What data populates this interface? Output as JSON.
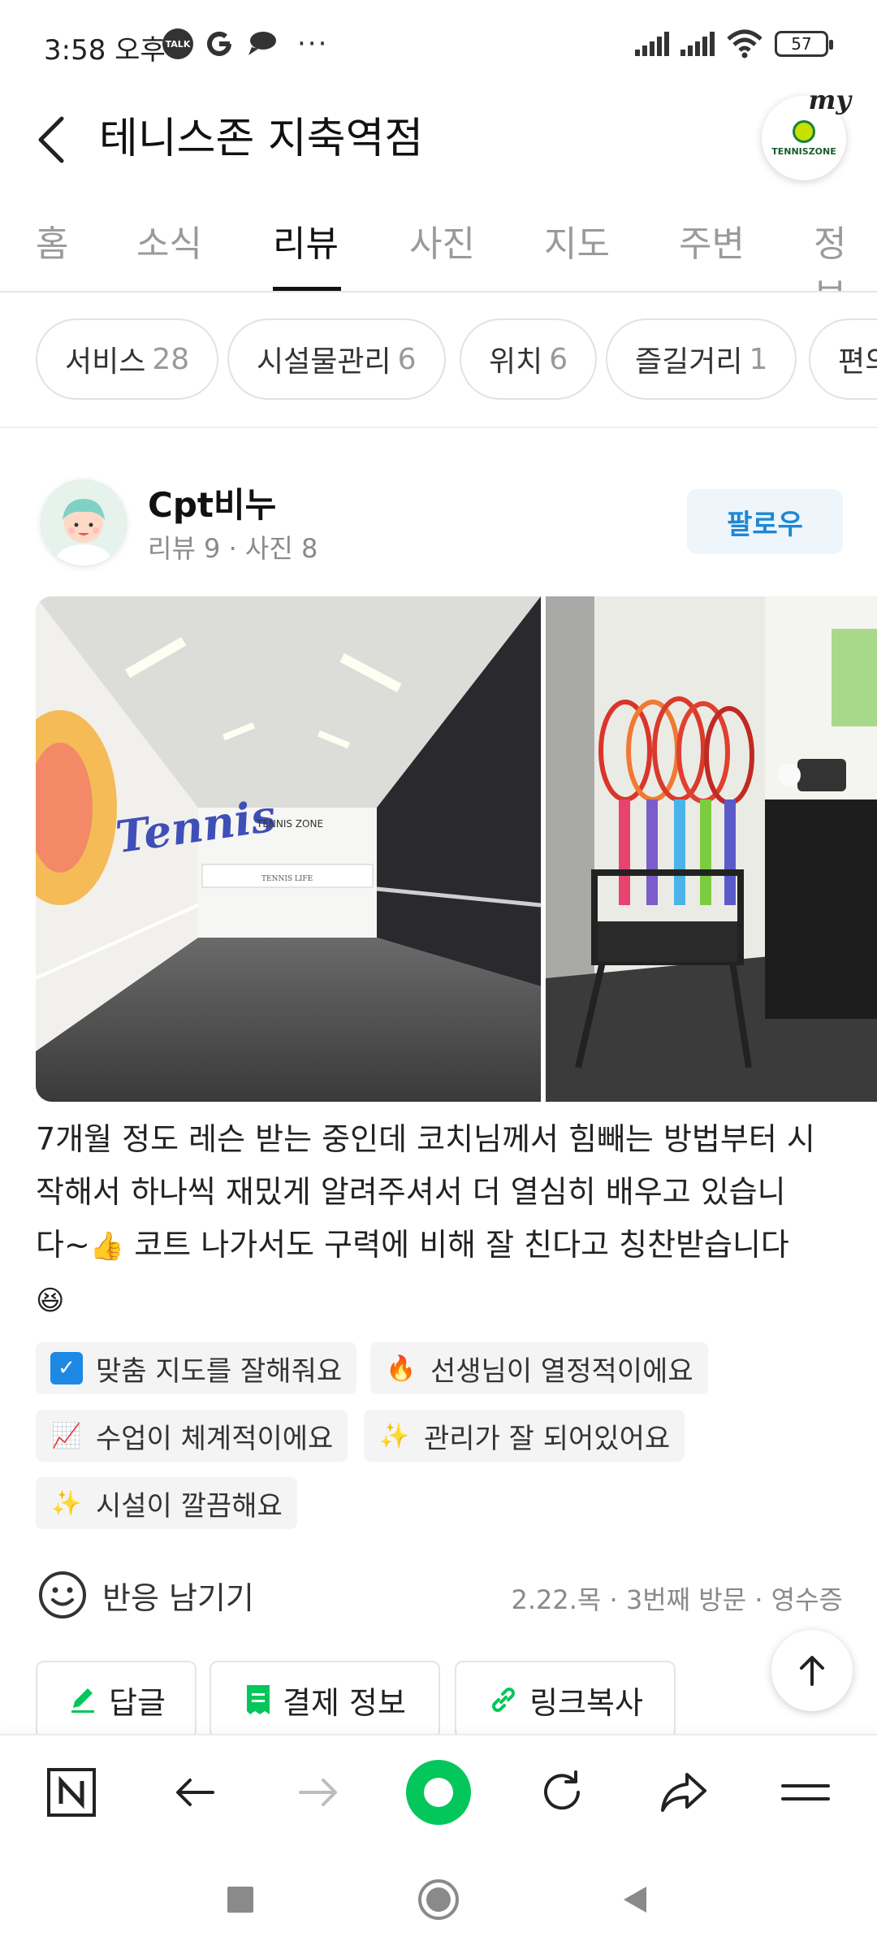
{
  "status": {
    "time": "3:58 오후",
    "battery": "57",
    "left_icons": [
      "talk-icon",
      "google-icon",
      "chat-icon"
    ]
  },
  "header": {
    "title": "테니스존 지축역점",
    "logo_my": "my",
    "logo_text": "TENNISZONE"
  },
  "tabs": [
    "홈",
    "소식",
    "리뷰",
    "사진",
    "지도",
    "주변",
    "정보"
  ],
  "active_tab": "리뷰",
  "chips": [
    {
      "label": "서비스",
      "count": "28"
    },
    {
      "label": "시설물관리",
      "count": "6"
    },
    {
      "label": "위치",
      "count": "6"
    },
    {
      "label": "즐길거리",
      "count": "1"
    },
    {
      "label": "편의",
      "count": ""
    }
  ],
  "review": {
    "author": "Cpt비누",
    "meta": "리뷰 9 · 사진 8",
    "follow_label": "팔로우",
    "text_line1": "7개월 정도 레슨 받는 중인데 코치님께서 힘빼는 방법부터 시",
    "text_line2": "작해서 하나씩 재밌게 알려주셔서 더 열심히 배우고 있습니",
    "text_line3_a": "다~",
    "text_line3_emoji": "👍",
    "text_line3_b": " 코트 나가서도 구력에 비해 잘 친다고 칭찬받습니다",
    "text_line4_emoji": "😆",
    "tags": [
      {
        "icon": "check-icon",
        "glyph": "✓",
        "label": "맞춤 지도를 잘해줘요"
      },
      {
        "icon": "fire-icon",
        "glyph": "🔥",
        "label": "선생님이 열정적이에요"
      },
      {
        "icon": "chart-up-icon",
        "glyph": "📈",
        "label": "수업이 체계적이에요"
      },
      {
        "icon": "sparkles-icon",
        "glyph": "✨",
        "label": "관리가 잘 되어있어요"
      },
      {
        "icon": "sparkles-icon",
        "glyph": "✨",
        "label": "시설이 깔끔해요"
      }
    ],
    "react_label": "반응 남기기",
    "visit_info": "2.22.목 · 3번째 방문 · 영수증"
  },
  "actions": {
    "reply": "답글",
    "payment": "결제 정보",
    "copy_link": "링크복사"
  },
  "photo1_signs": [
    "TENNIS ZONE",
    "TENNIS LIFE",
    "Tennis"
  ],
  "colors": {
    "accent_blue": "#1e88d4",
    "naver_green": "#03c75a"
  }
}
